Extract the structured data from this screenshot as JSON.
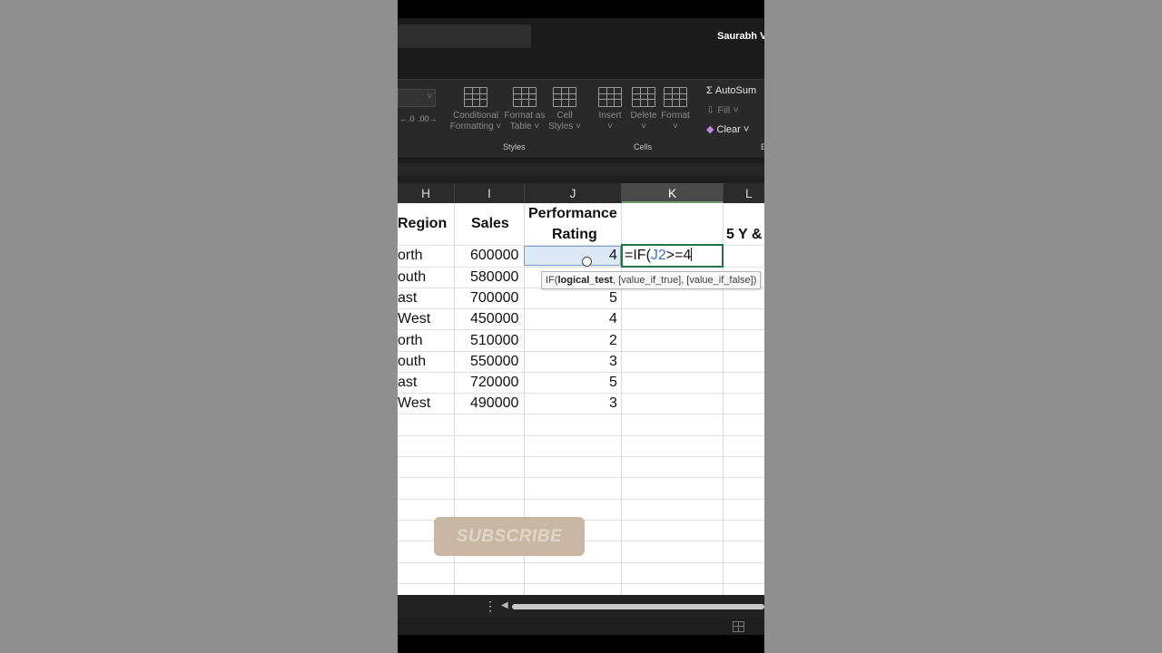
{
  "titlebar": {
    "user": "Saurabh Vis"
  },
  "ribbon": {
    "items": [
      {
        "label": "Conditional\nFormatting ˅"
      },
      {
        "label": "Format as\nTable ˅"
      },
      {
        "label": "Cell\nStyles ˅"
      },
      {
        "label": "Insert\n˅"
      },
      {
        "label": "Delete\n˅"
      },
      {
        "label": "Format\n˅"
      }
    ],
    "groups": {
      "styles": "Styles",
      "cells": "Cells",
      "editing_partial": "E"
    },
    "autosum": "AutoSum",
    "fill": "Fill ˅",
    "clear": "Clear ˅",
    "number_format_icons": [
      "←.0",
      ".00→"
    ]
  },
  "columns": [
    "H",
    "I",
    "J",
    "K",
    "L"
  ],
  "headers": {
    "region": "Region",
    "sales": "Sales",
    "rating_line1": "Performance",
    "rating_line2": "Rating",
    "l_partial": "5 Y &"
  },
  "rows": [
    {
      "region": "orth",
      "sales": "600000",
      "rating": "4"
    },
    {
      "region": "outh",
      "sales": "580000",
      "rating": ""
    },
    {
      "region": "ast",
      "sales": "700000",
      "rating": "5"
    },
    {
      "region": "West",
      "sales": "450000",
      "rating": "4"
    },
    {
      "region": "orth",
      "sales": "510000",
      "rating": "2"
    },
    {
      "region": "outh",
      "sales": "550000",
      "rating": "3"
    },
    {
      "region": "ast",
      "sales": "720000",
      "rating": "5"
    },
    {
      "region": "West",
      "sales": "490000",
      "rating": "3"
    }
  ],
  "formula": {
    "prefix": "=IF(",
    "ref": "J2",
    "suffix": ">=4"
  },
  "tooltip": {
    "fn": "IF(",
    "arg_bold": "logical_test",
    "rest": ", [value_if_true], [value_if_false])"
  },
  "watermark": "SUBSCRIBE",
  "colors": {
    "ref_blue": "#4472c4",
    "edit_border": "#217346"
  }
}
